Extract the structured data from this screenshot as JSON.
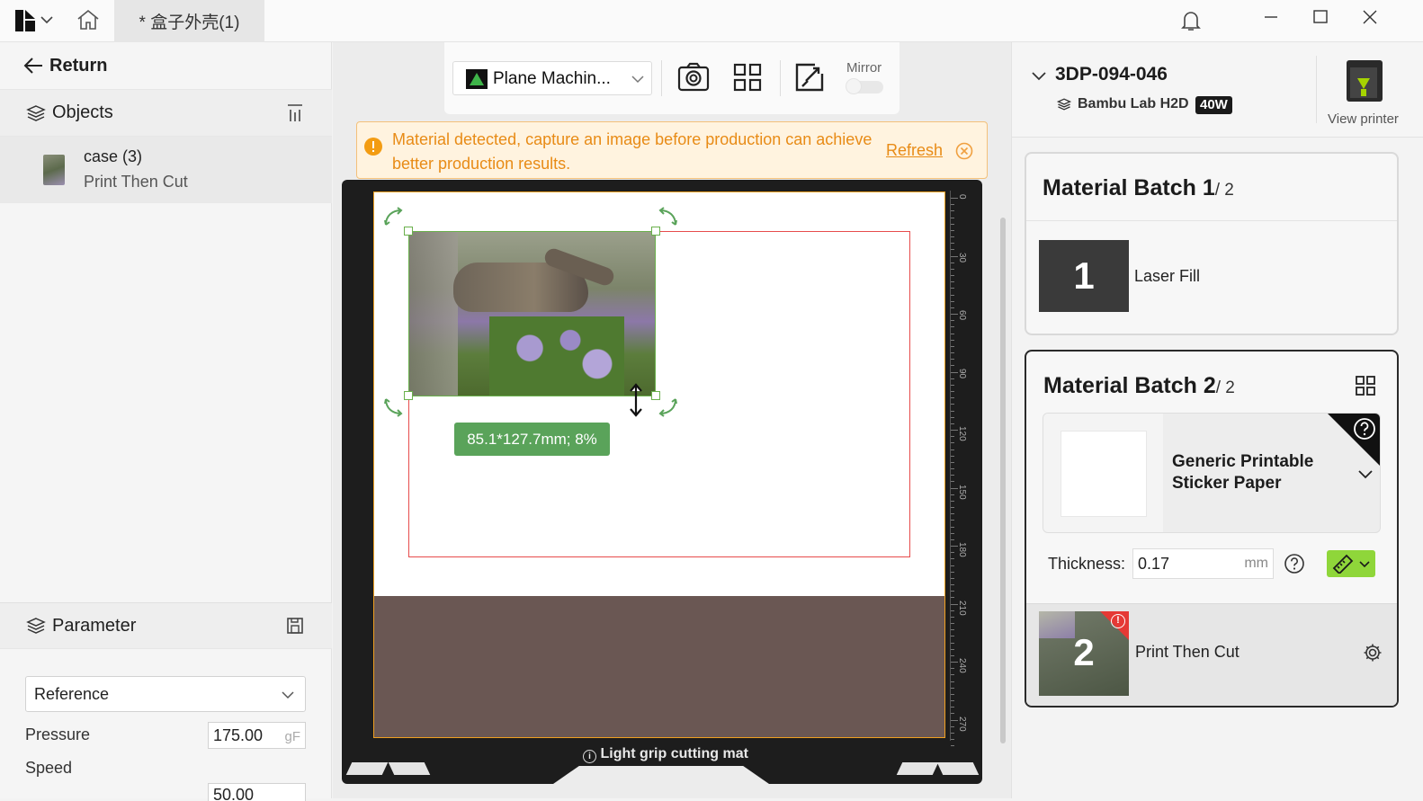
{
  "titlebar": {
    "doc_tab": "* 盒子外壳(1)",
    "icons": [
      "app-logo-icon",
      "chevron-down-icon",
      "home-icon",
      "bell-icon",
      "minimize-icon",
      "maximize-icon",
      "close-icon"
    ]
  },
  "left": {
    "return_label": "Return",
    "objects_label": "Objects",
    "object": {
      "name": "case (3)",
      "mode": "Print Then Cut"
    },
    "parameter_label": "Parameter",
    "preset": "Reference",
    "pressure_label": "Pressure",
    "pressure_value": "175.00",
    "pressure_unit": "gF",
    "speed_label": "Speed",
    "speed_value_partial": "50.00"
  },
  "toolbar": {
    "machine": "Plane Machin...",
    "mirror_label": "Mirror"
  },
  "banner": {
    "message": "Material detected, capture an image before production can achieve better production results.",
    "refresh": "Refresh"
  },
  "canvas": {
    "size_label": "85.1*127.7mm; 8%",
    "ruler_ticks": [
      "0",
      "30",
      "60",
      "90",
      "120",
      "150",
      "180",
      "210",
      "240",
      "270"
    ],
    "mat_label": "Light grip cutting mat"
  },
  "printer": {
    "name": "3DP-094-046",
    "model": "Bambu Lab H2D",
    "power_badge": "40W",
    "view_printer": "View printer"
  },
  "batch1": {
    "title": "Material Batch 1",
    "total": "/ 2",
    "number": "1",
    "operation": "Laser Fill"
  },
  "batch2": {
    "title": "Material Batch 2",
    "total": "/ 2",
    "material": "Generic Printable Sticker Paper",
    "thickness_label": "Thickness:",
    "thickness_value": "0.17",
    "thickness_unit": "mm",
    "number": "2",
    "operation": "Print Then Cut"
  },
  "colors": {
    "accent_green": "#5aa35a",
    "warning_orange": "#f39c12",
    "error_red": "#e53935"
  }
}
